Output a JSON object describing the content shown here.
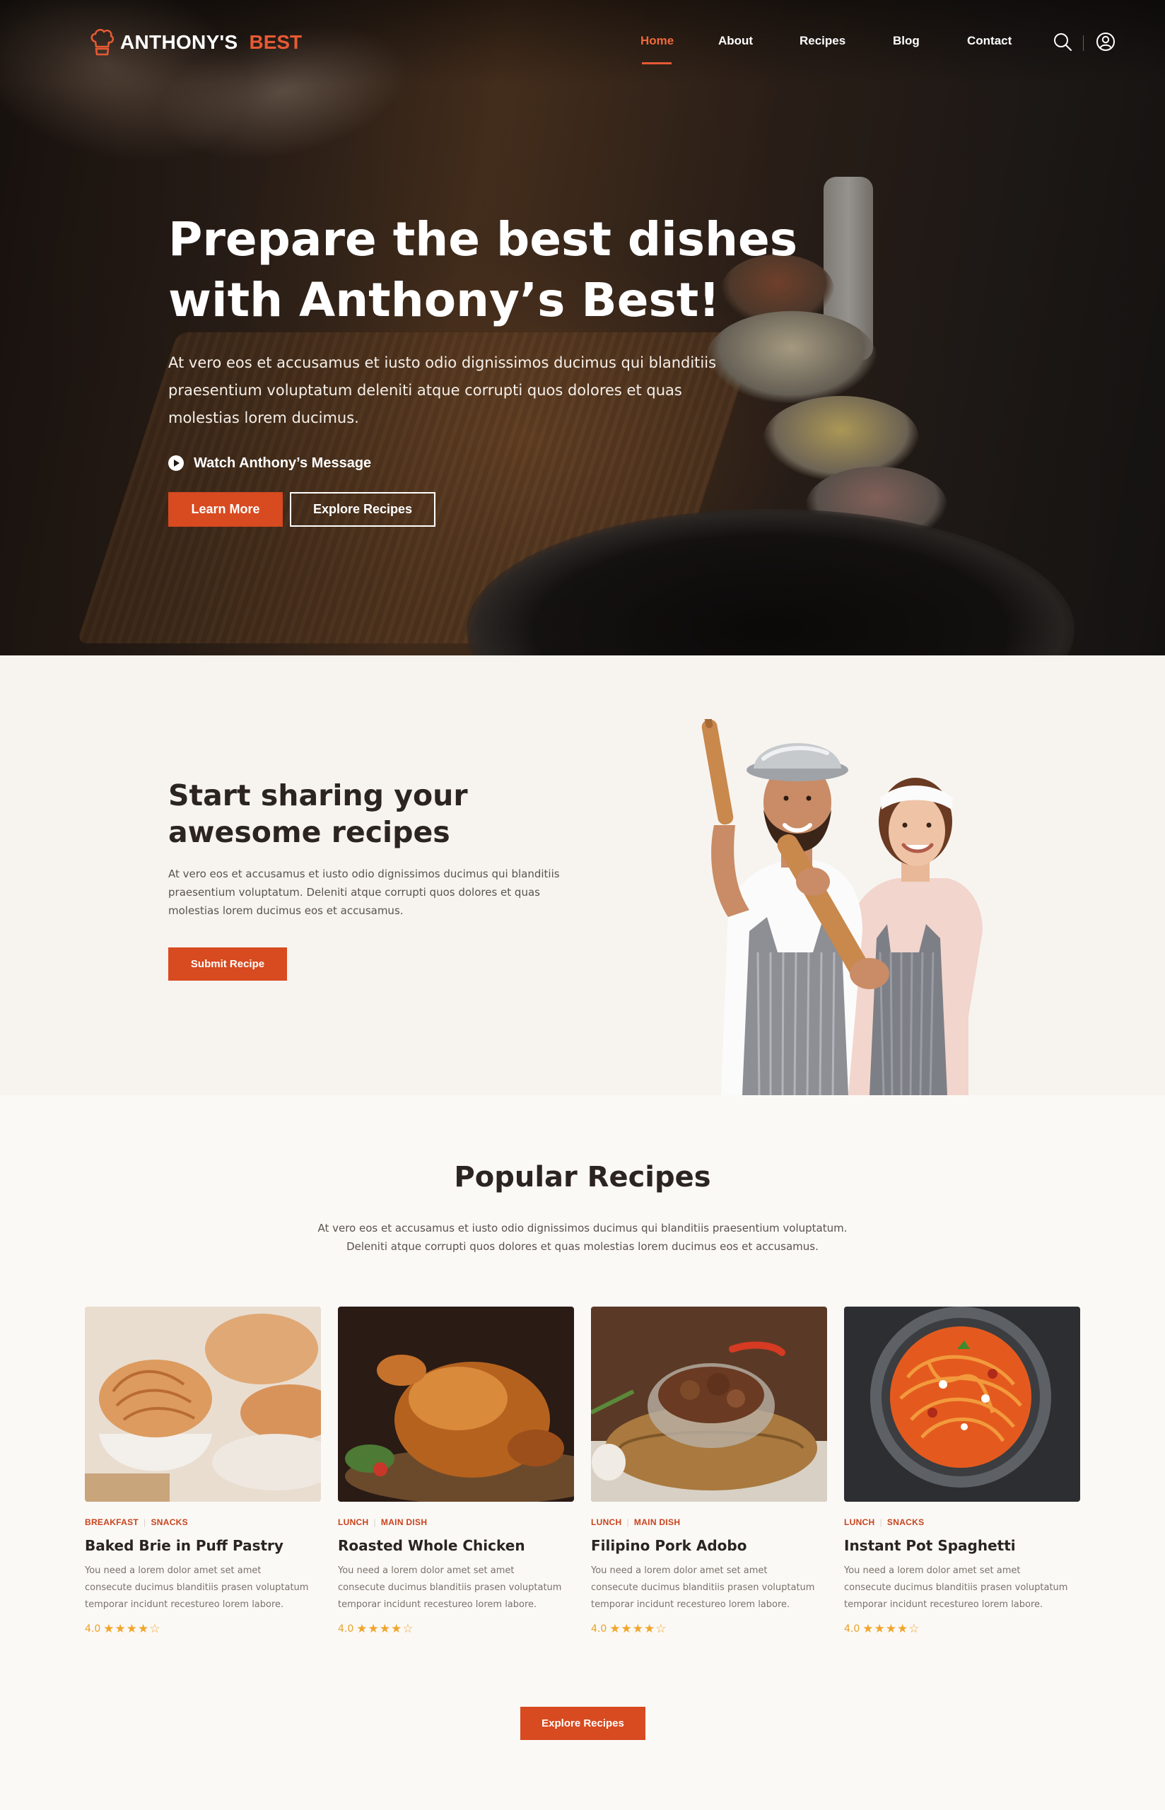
{
  "brand": {
    "name_part1": "ANTHONY'S",
    "name_part2": "BEST"
  },
  "nav": {
    "items": [
      {
        "label": "Home",
        "active": true
      },
      {
        "label": "About"
      },
      {
        "label": "Recipes"
      },
      {
        "label": "Blog"
      },
      {
        "label": "Contact"
      }
    ],
    "icons": [
      "search-icon",
      "user-icon"
    ]
  },
  "hero": {
    "title_line1": "Prepare the best dishes",
    "title_line2": "with Anthony’s Best!",
    "text": "At vero eos et accusamus et iusto odio dignissimos ducimus qui blanditiis praesentium voluptatum deleniti atque corrupti quos dolores et quas molestias lorem ducimus.",
    "watch_label": "Watch Anthony’s Message",
    "learn_more": "Learn More",
    "explore_recipes": "Explore Recipes"
  },
  "share": {
    "title": "Start sharing your awesome recipes",
    "text": "At vero eos et accusamus et iusto odio dignissimos ducimus qui blanditiis praesentium voluptatum. Deleniti atque corrupti quos dolores et quas molestias lorem ducimus eos et accusamus.",
    "button": "Submit Recipe"
  },
  "popular": {
    "title": "Popular Recipes",
    "text": "At vero eos et accusamus et iusto odio dignissimos ducimus qui blanditiis praesentium voluptatum. Deleniti atque corrupti quos dolores et quas molestias lorem ducimus eos et accusamus.",
    "cards": [
      {
        "tag1": "BREAKFAST",
        "tag2": "SNACKS",
        "title": "Baked Brie in Puff Pastry",
        "desc": "You need a lorem dolor amet set amet consecute ducimus blanditiis prasen voluptatum temporar incidunt recestureo lorem labore.",
        "rating": "4.0",
        "stars": "★★★★☆"
      },
      {
        "tag1": "LUNCH",
        "tag2": "MAIN DISH",
        "title": "Roasted Whole Chicken",
        "desc": "You need a lorem dolor amet set amet consecute ducimus blanditiis prasen voluptatum temporar incidunt recestureo lorem labore.",
        "rating": "4.0",
        "stars": "★★★★☆"
      },
      {
        "tag1": "LUNCH",
        "tag2": "MAIN DISH",
        "title": "Filipino Pork Adobo",
        "desc": "You need a lorem dolor amet set amet consecute ducimus blanditiis prasen voluptatum temporar incidunt recestureo lorem labore.",
        "rating": "4.0",
        "stars": "★★★★☆"
      },
      {
        "tag1": "LUNCH",
        "tag2": "SNACKS",
        "title": "Instant Pot Spaghetti",
        "desc": "You need a lorem dolor amet set amet consecute ducimus blanditiis prasen voluptatum temporar incidunt recestureo lorem labore.",
        "rating": "4.0",
        "stars": "★★★★☆"
      }
    ],
    "explore_button": "Explore Recipes"
  },
  "colors": {
    "accent": "#d84a20",
    "nav_active": "#ee6a3c",
    "star": "#f1a52a",
    "tag": "#c8431d"
  }
}
